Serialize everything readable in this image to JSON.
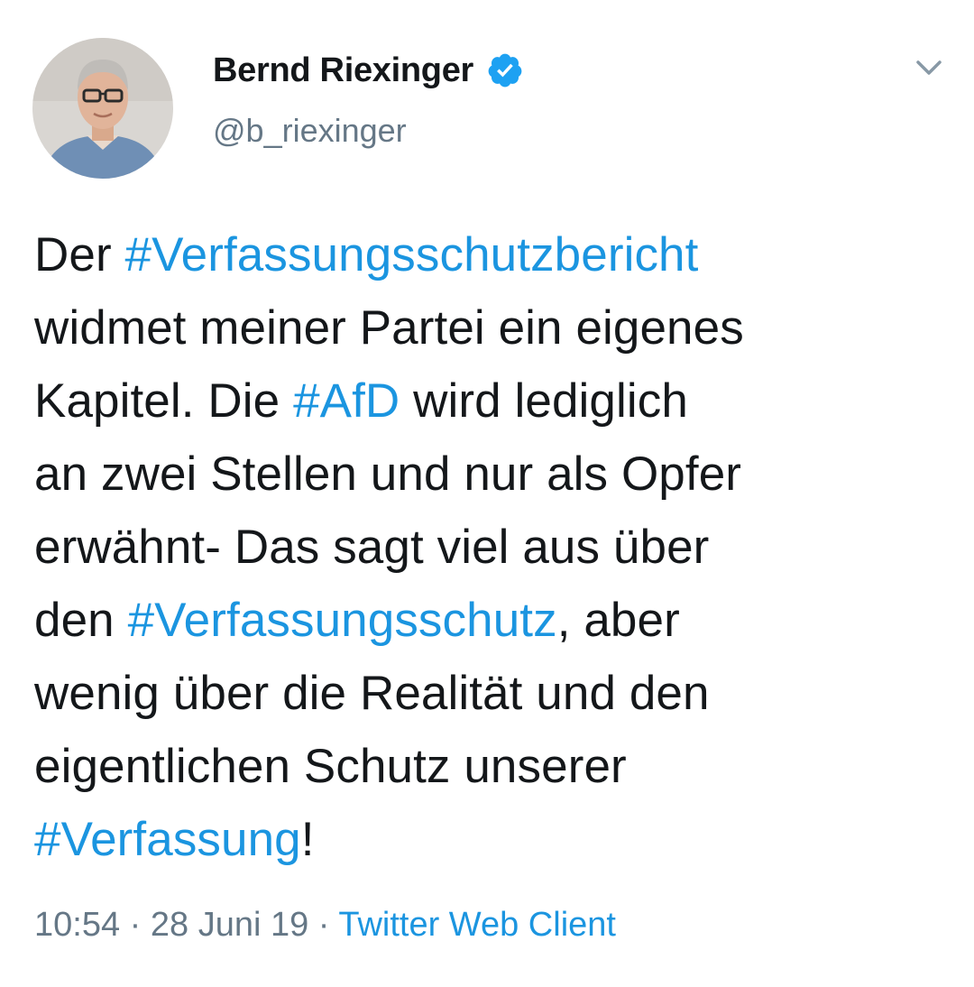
{
  "author": {
    "display_name": "Bernd Riexinger",
    "handle": "@b_riexinger",
    "verified": true,
    "avatar_icon": "profile-photo-avatar",
    "verified_icon": "verified-badge-icon"
  },
  "menu": {
    "caret_icon": "chevron-down-icon"
  },
  "tweet": {
    "line1_a": "Der ",
    "line1_tag": "#Verfassungsschutzbericht",
    "line2": "widmet meiner Partei ein eigenes",
    "line3_a": "Kapitel. Die ",
    "line3_tag": "#AfD",
    "line3_b": " wird lediglich",
    "line4": "an zwei Stellen und nur als Opfer",
    "line5": "erwähnt- Das sagt viel aus über",
    "line6_a": "den ",
    "line6_tag": "#Verfassungsschutz",
    "line6_b": ", aber",
    "line7": "wenig über die Realität und den",
    "line8": "eigentlichen Schutz unserer",
    "line9_tag": "#Verfassung",
    "line9_b": "!"
  },
  "meta": {
    "time": "10:54",
    "sep1": " · ",
    "date": "28 Juni 19",
    "sep2": " · ",
    "source": "Twitter Web Client"
  },
  "colors": {
    "text": "#14171a",
    "secondary": "#657786",
    "link": "#1b95e0",
    "verified": "#1da1f2"
  }
}
